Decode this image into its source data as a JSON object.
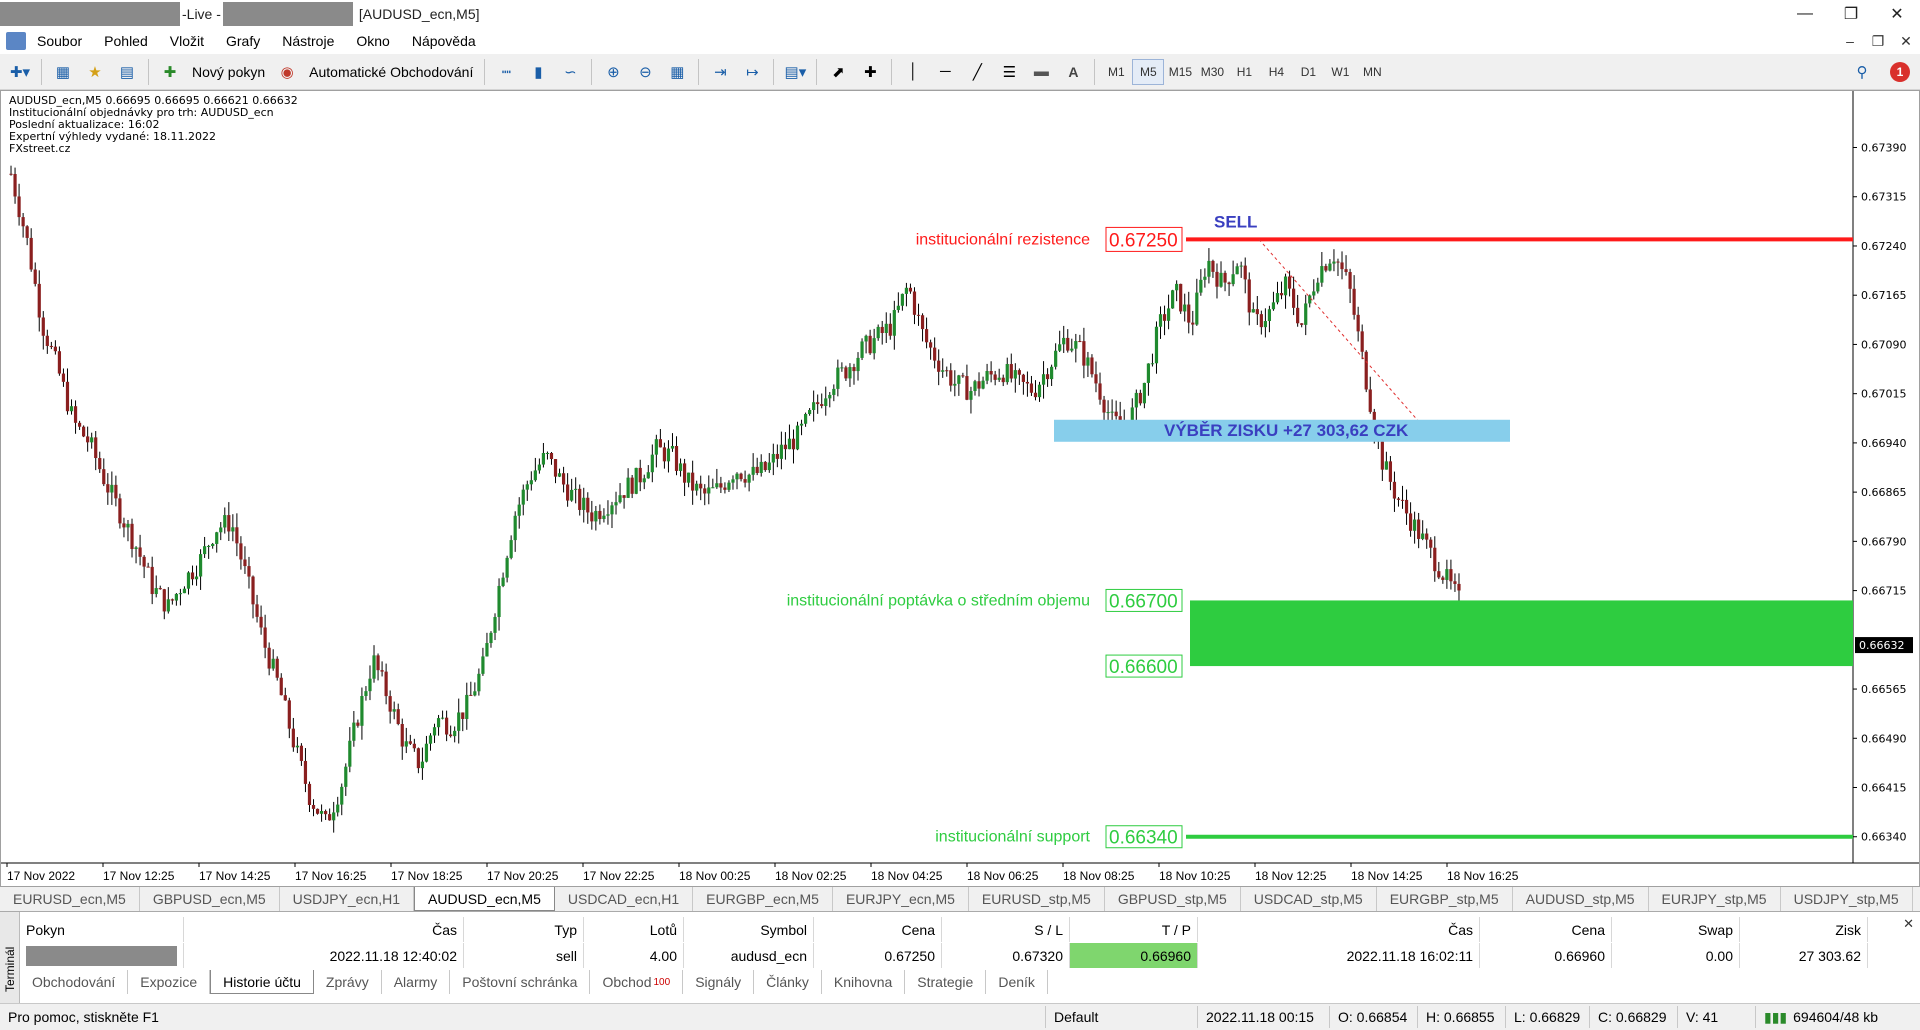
{
  "window": {
    "title_live": "-Live - ",
    "title_chart": "[AUDUSD_ecn,M5]"
  },
  "menu": [
    "Soubor",
    "Pohled",
    "Vložit",
    "Grafy",
    "Nástroje",
    "Okno",
    "Nápověda"
  ],
  "toolbar": {
    "new_order": "Nový pokyn",
    "auto_trading": "Automatické Obchodování",
    "text_tool": "A",
    "timeframes": [
      "M1",
      "M5",
      "M15",
      "M30",
      "H1",
      "H4",
      "D1",
      "W1",
      "MN"
    ],
    "active_timeframe": "M5",
    "notification_count": "1"
  },
  "chart_info": {
    "line1": "AUDUSD_ecn,M5  0.66695 0.66695 0.66621 0.66632",
    "line2": "Institucionální objednávky pro trh: AUDUSD_ecn",
    "line3": "Poslední aktualizace: 16:02",
    "line4": "Expertní výhledy vydané: 18.11.2022",
    "line5": "FXstreet.cz"
  },
  "chart_data": {
    "type": "candlestick",
    "symbol": "AUDUSD_ecn",
    "timeframe": "M5",
    "ylim": [
      0.663,
      0.6747
    ],
    "y_ticks": [
      "0.67390",
      "0.67315",
      "0.67240",
      "0.67165",
      "0.67090",
      "0.67015",
      "0.66940",
      "0.66865",
      "0.66790",
      "0.66715",
      "0.66565",
      "0.66490",
      "0.66415",
      "0.66340"
    ],
    "current_price": "0.66632",
    "x_ticks": [
      "17 Nov 2022",
      "17 Nov 12:25",
      "17 Nov 14:25",
      "17 Nov 16:25",
      "17 Nov 18:25",
      "17 Nov 20:25",
      "17 Nov 22:25",
      "18 Nov 00:25",
      "18 Nov 02:25",
      "18 Nov 04:25",
      "18 Nov 06:25",
      "18 Nov 08:25",
      "18 Nov 10:25",
      "18 Nov 12:25",
      "18 Nov 14:25",
      "18 Nov 16:25"
    ],
    "close_path": [
      0.6735,
      0.6725,
      0.6712,
      0.6705,
      0.6697,
      0.6694,
      0.6688,
      0.6683,
      0.6678,
      0.6672,
      0.6669,
      0.6673,
      0.6676,
      0.6681,
      0.6682,
      0.6673,
      0.6664,
      0.6657,
      0.6648,
      0.664,
      0.6636,
      0.6642,
      0.6652,
      0.6661,
      0.6655,
      0.6648,
      0.6645,
      0.6652,
      0.6651,
      0.6654,
      0.666,
      0.6672,
      0.6683,
      0.6689,
      0.6692,
      0.6688,
      0.6685,
      0.6683,
      0.6685,
      0.6687,
      0.6689,
      0.6693,
      0.6692,
      0.6688,
      0.6686,
      0.6687,
      0.669,
      0.6689,
      0.669,
      0.6693,
      0.6695,
      0.6699,
      0.6703,
      0.6705,
      0.6708,
      0.671,
      0.6712,
      0.6718,
      0.671,
      0.6706,
      0.6703,
      0.6702,
      0.6704,
      0.6705,
      0.6703,
      0.6702,
      0.6706,
      0.671,
      0.6708,
      0.6703,
      0.6697,
      0.6697,
      0.6703,
      0.6712,
      0.6717,
      0.6712,
      0.6722,
      0.6718,
      0.6722,
      0.6712,
      0.6714,
      0.6718,
      0.6712,
      0.672,
      0.6723,
      0.6718,
      0.6705,
      0.6692,
      0.6686,
      0.6682,
      0.6678,
      0.6674,
      0.667
    ],
    "candle_count": 360,
    "annotations": {
      "resistance_label": "institucionální rezistence",
      "resistance_price": "0.67250",
      "resistance_value": 0.6725,
      "sell_label": "SELL",
      "profit_label": "VÝBĚR ZISKU +27 303,62 CZK",
      "profit_value": 0.6696,
      "demand_label": "institucionální poptávka o středním objemu",
      "demand_upper": "0.66700",
      "demand_upper_value": 0.667,
      "demand_lower": "0.66600",
      "demand_lower_value": 0.666,
      "support_label": "institucionální support",
      "support_price": "0.66340",
      "support_value": 0.6634
    },
    "colors": {
      "bull": "#1f8a2e",
      "bear": "#8a1f1f",
      "resistance": "#ff1a1a",
      "demand": "#2ecc40",
      "profit_box": "#87ceeb",
      "sell_text": "#3a3fc0"
    }
  },
  "chart_tabs": [
    "EURUSD_ecn,M5",
    "GBPUSD_ecn,M5",
    "USDJPY_ecn,H1",
    "AUDUSD_ecn,M5",
    "USDCAD_ecn,H1",
    "EURGBP_ecn,M5",
    "EURJPY_ecn,M5",
    "EURUSD_stp,M5",
    "GBPUSD_stp,M5",
    "USDCAD_stp,M5",
    "EURGBP_stp,M5",
    "AUDUSD_stp,M5",
    "EURJPY_stp,M5",
    "USDJPY_stp,M5"
  ],
  "active_chart_tab": "AUDUSD_ecn,M5",
  "terminal": {
    "side_label": "Terminál",
    "headers": [
      "Pokyn",
      "Čas",
      "Typ",
      "Lotů",
      "Symbol",
      "Cena",
      "S / L",
      "T / P",
      "Čas",
      "Cena",
      "Swap",
      "Zisk"
    ],
    "row": [
      "",
      "2022.11.18 12:40:02",
      "sell",
      "4.00",
      "audusd_ecn",
      "0.67250",
      "0.67320",
      "0.66960",
      "2022.11.18 16:02:11",
      "0.66960",
      "0.00",
      "27 303.62"
    ],
    "tabs": [
      "Obchodování",
      "Expozice",
      "Historie účtu",
      "Zprávy",
      "Alarmy",
      "Poštovní schránka",
      "Obchod",
      "Signály",
      "Články",
      "Knihovna",
      "Strategie",
      "Deník"
    ],
    "active_tab": "Historie účtu",
    "trade_badge": "100"
  },
  "status": {
    "help": "Pro pomoc, stiskněte F1",
    "profile": "Default",
    "time": "2022.11.18 00:15",
    "open": "O: 0.66854",
    "high": "H: 0.66855",
    "low": "L: 0.66829",
    "close": "C: 0.66829",
    "volume": "V: 41",
    "traffic": "694604/48 kb"
  }
}
